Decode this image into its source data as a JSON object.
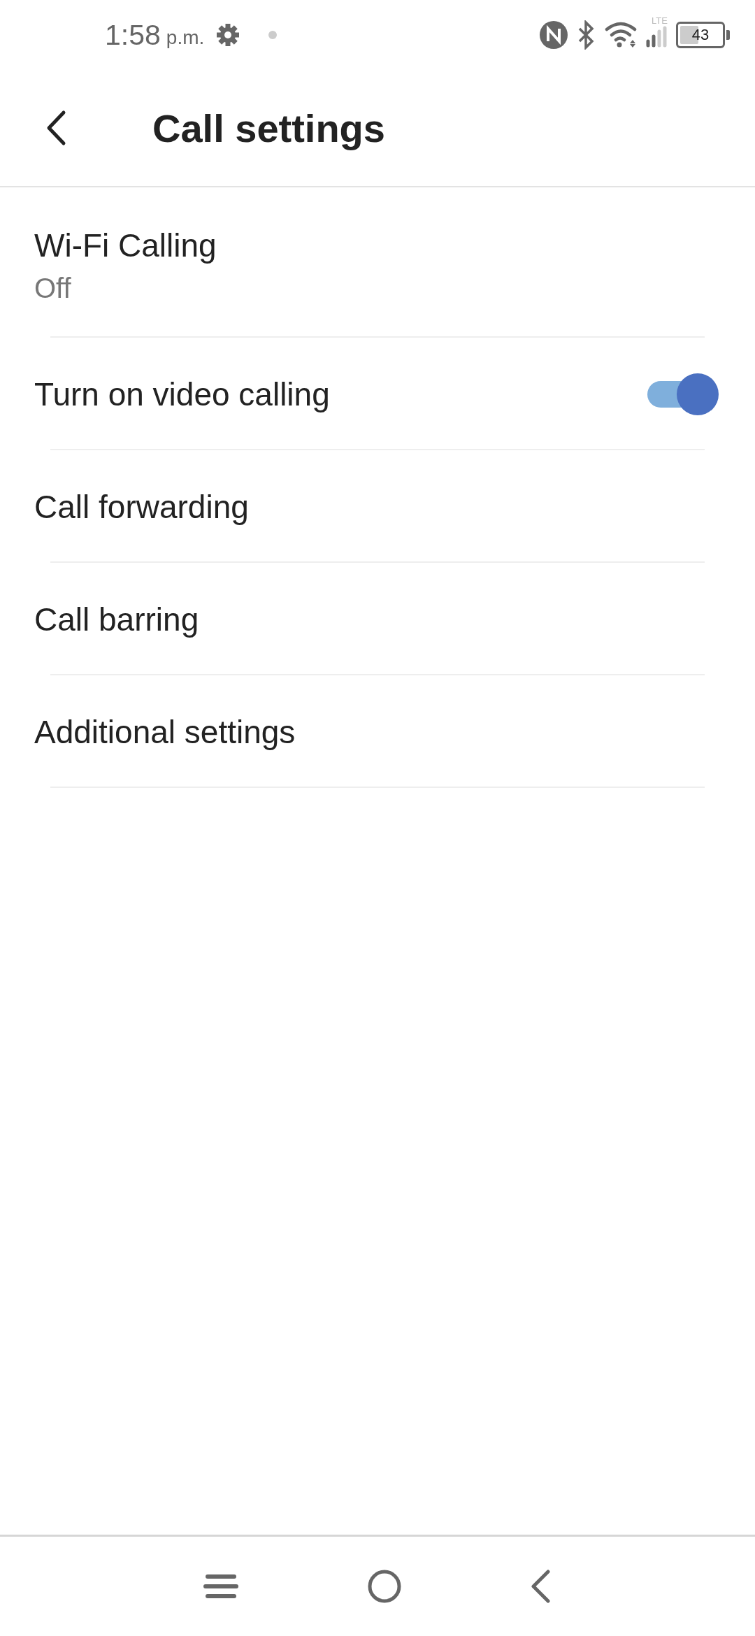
{
  "status_bar": {
    "time": "1:58",
    "ampm": "p.m.",
    "network_label": "LTE",
    "battery": "43"
  },
  "header": {
    "title": "Call settings"
  },
  "rows": [
    {
      "kind": "subtitle",
      "title": "Wi-Fi Calling",
      "subtitle": "Off"
    },
    {
      "kind": "toggle",
      "title": "Turn on video calling",
      "on": true
    },
    {
      "kind": "plain",
      "title": "Call forwarding"
    },
    {
      "kind": "plain",
      "title": "Call barring"
    },
    {
      "kind": "plain",
      "title": "Additional settings"
    }
  ]
}
